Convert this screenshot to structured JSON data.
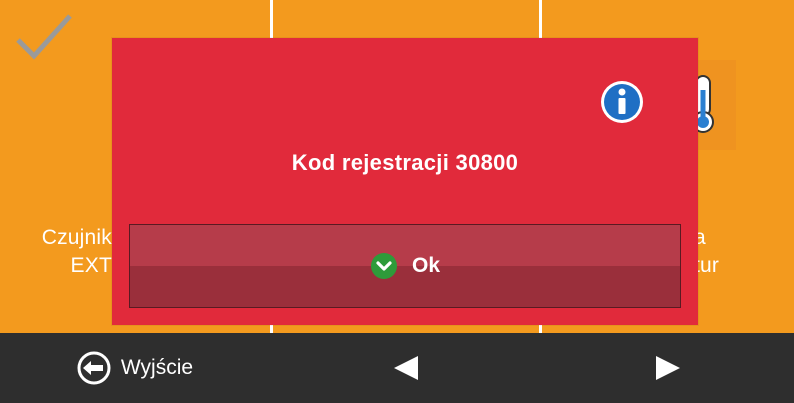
{
  "screen": {
    "left_label_line1": "Czujnik",
    "left_label_line2": "EXT",
    "right_label_line1": "a",
    "right_label_line2": "tur",
    "icons": [
      "check-icon",
      "thermometer-icon"
    ]
  },
  "dialog": {
    "message": "Kod rejestracji 30800",
    "icon": "info-icon",
    "ok_label": "Ok",
    "ok_icon": "chevron-down-icon"
  },
  "toolbar": {
    "exit_label": "Wyjście",
    "exit_icon": "exit-arrow-icon",
    "prev_icon": "triangle-left-icon",
    "next_icon": "triangle-right-icon"
  },
  "colors": {
    "background": "#f39a1e",
    "dialog": "#e12a3b",
    "toolbar": "#2e2e2e",
    "info": "#1f6fc4",
    "ok_icon": "#2e9b3a"
  }
}
